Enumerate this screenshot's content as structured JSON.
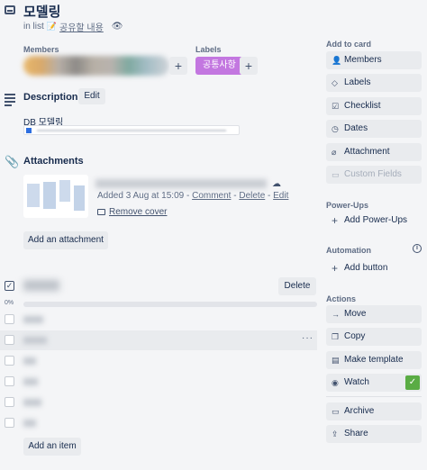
{
  "card": {
    "title": "모델링",
    "in_list_prefix": "in list",
    "list_emoji": "📝",
    "list_name": "공유할 내용",
    "watch_icon": "eye-icon"
  },
  "members": {
    "heading": "Members",
    "add_icon": "plus-icon"
  },
  "labels": {
    "heading": "Labels",
    "items": [
      "공통사항"
    ],
    "add_icon": "plus-icon",
    "label_color": "#c377e0"
  },
  "description": {
    "heading": "Description",
    "edit_label": "Edit",
    "text": "DB 모델링"
  },
  "attachments": {
    "heading": "Attachments",
    "item": {
      "meta_prefix": "Added 3 Aug at 15:09 - ",
      "comment": "Comment",
      "sep1": " - ",
      "delete": "Delete",
      "sep2": " - ",
      "edit": "Edit",
      "remove_cover": "Remove cover"
    },
    "add_label": "Add an attachment"
  },
  "checklist": {
    "delete_label": "Delete",
    "progress": "0%",
    "progress_value": 0,
    "add_item_label": "Add an item",
    "more_label": "···"
  },
  "sidebar": {
    "add_to_card": {
      "heading": "Add to card",
      "items": [
        {
          "label": "Members",
          "icon": "person-icon"
        },
        {
          "label": "Labels",
          "icon": "tag-icon"
        },
        {
          "label": "Checklist",
          "icon": "checklist-icon"
        },
        {
          "label": "Dates",
          "icon": "clock-icon"
        },
        {
          "label": "Attachment",
          "icon": "paperclip-icon"
        },
        {
          "label": "Custom Fields",
          "icon": "custom-fields-icon"
        }
      ]
    },
    "power_ups": {
      "heading": "Power-Ups",
      "add_label": "Add Power-Ups"
    },
    "automation": {
      "heading": "Automation",
      "add_label": "Add button",
      "info_icon": "info-icon"
    },
    "actions": {
      "heading": "Actions",
      "items": [
        {
          "label": "Move",
          "icon": "arrow-right-icon"
        },
        {
          "label": "Copy",
          "icon": "copy-icon"
        },
        {
          "label": "Make template",
          "icon": "template-icon"
        },
        {
          "label": "Watch",
          "icon": "eye-icon"
        },
        {
          "label": "Archive",
          "icon": "archive-icon"
        },
        {
          "label": "Share",
          "icon": "share-icon"
        }
      ]
    }
  },
  "colors": {
    "accent_green": "#5aac44",
    "label_purple": "#c377e0",
    "text": "#172b4d"
  }
}
